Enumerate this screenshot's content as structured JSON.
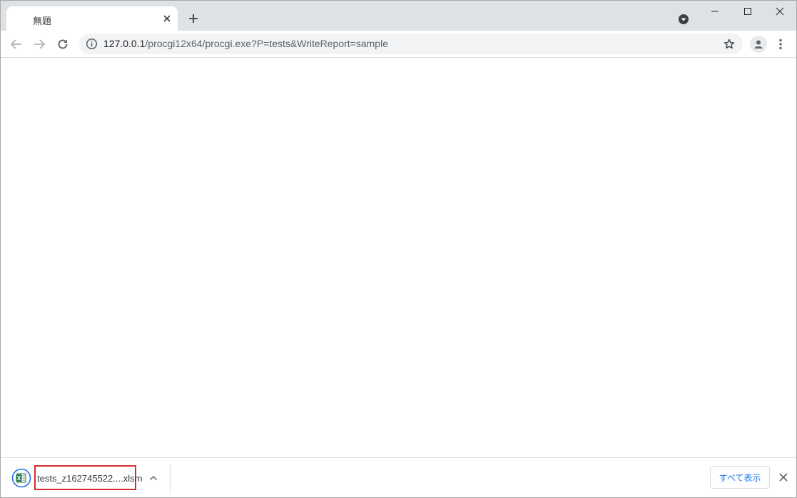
{
  "tab": {
    "title": "無題"
  },
  "omnibox": {
    "host": "127.0.0.1",
    "path": "/procgi12x64/procgi.exe?P=tests&WriteReport=sample"
  },
  "download_shelf": {
    "item": {
      "filename": "tests_z162745522....xlsm",
      "icon": "excel-file-icon"
    },
    "show_all_label": "すべて表示"
  },
  "colors": {
    "tabstrip_bg": "#dee1e6",
    "omnibox_bg": "#f1f3f4",
    "highlight_border": "#d32f2f",
    "link_blue": "#1a73e8"
  }
}
